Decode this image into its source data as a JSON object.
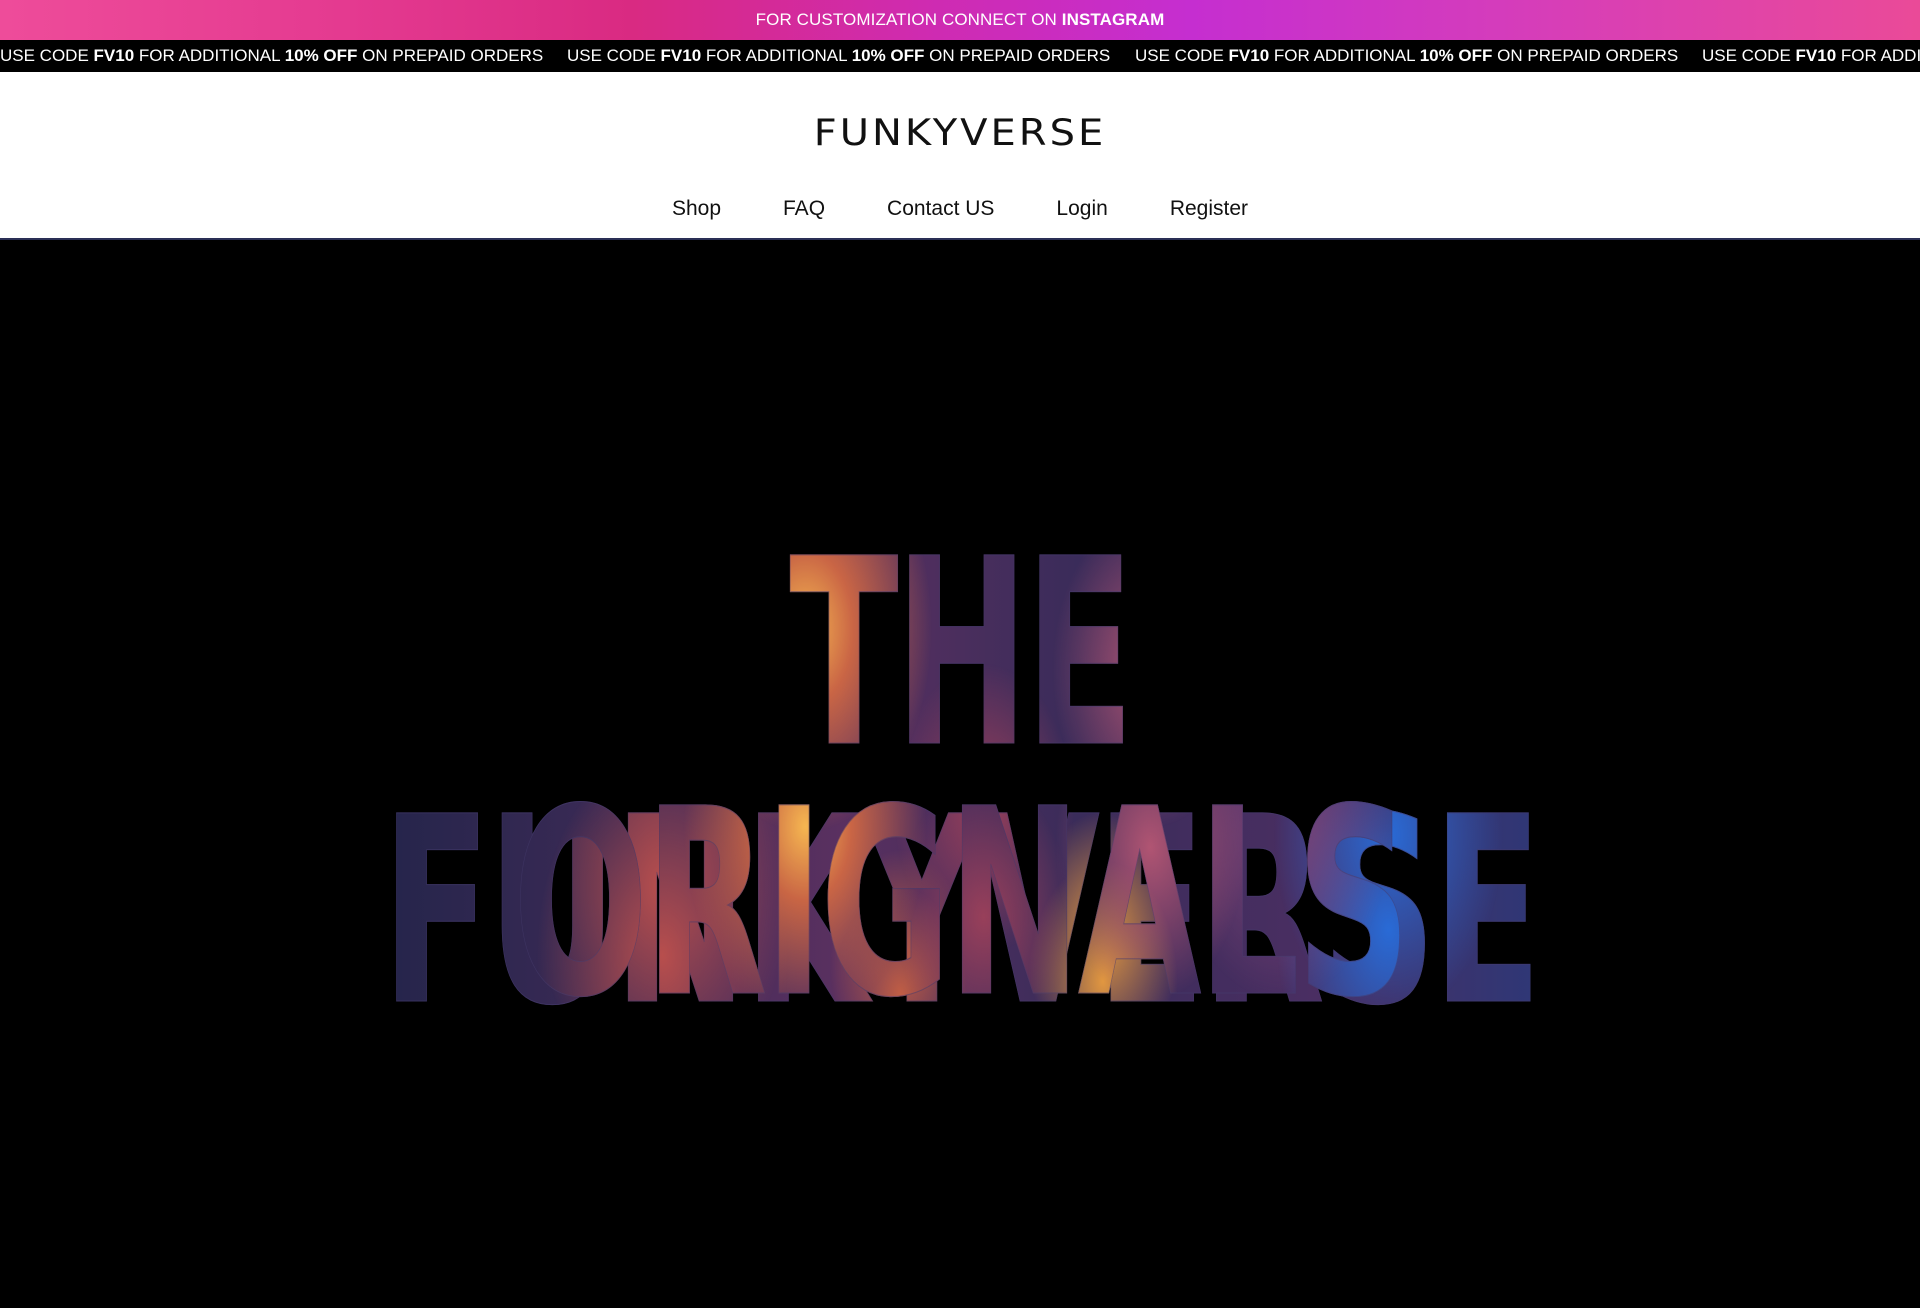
{
  "promo": {
    "text": "FOR CUSTOMIZATION CONNECT ON ",
    "highlight": "INSTAGRAM"
  },
  "ticker": {
    "items": [
      {
        "prefix": "USE CODE ",
        "code": "FV10",
        "middle": " FOR ADDITIONAL ",
        "discount": "10% OFF",
        "suffix": " ON PREPAID ORDERS"
      },
      {
        "prefix": "USE CODE ",
        "code": "FV10",
        "middle": " FOR ADDITIONAL ",
        "discount": "10% OFF",
        "suffix": " ON PREPAID ORDERS"
      },
      {
        "prefix": "USE CODE ",
        "code": "FV10",
        "middle": " FOR ADDITIONAL ",
        "discount": "10% OFF",
        "suffix": " ON PREPAID ORDERS"
      },
      {
        "prefix": "USE CODE ",
        "code": "FV10",
        "middle": " FOR ADDITI",
        "discount": "",
        "suffix": ""
      }
    ]
  },
  "header": {
    "logo": "FUNKYVERSE",
    "nav": [
      {
        "label": "Shop"
      },
      {
        "label": "FAQ"
      },
      {
        "label": "Contact US"
      },
      {
        "label": "Login"
      },
      {
        "label": "Register"
      }
    ]
  },
  "hero": {
    "line1": "THE FUNKYVERSE",
    "line2": "ORIGNALS"
  },
  "colors": {
    "promo_gradient_start": "#ee4c9a",
    "promo_gradient_mid": "#c52ed0",
    "ticker_bg": "#000000",
    "header_bg": "#ffffff",
    "hero_bg": "#000000"
  }
}
